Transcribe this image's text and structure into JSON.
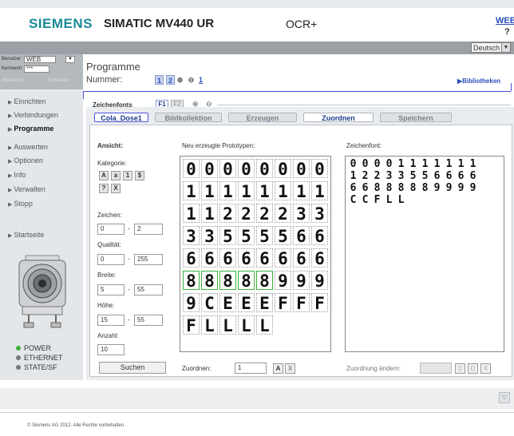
{
  "header": {
    "brand": "SIEMENS",
    "product": "SIMATIC MV440 UR",
    "mode": "OCR+",
    "web_link": "WEB",
    "help": "?",
    "language": "Deutsch"
  },
  "login": {
    "user_label": "Benutzer",
    "user_value": "WEB",
    "password_label": "Kennwort",
    "password_value": "***",
    "logout": "Abmelden",
    "login": "Anmelden"
  },
  "nav": {
    "items": [
      {
        "label": "Einrichten",
        "active": false
      },
      {
        "label": "Verbindungen",
        "active": false
      },
      {
        "label": "Programme",
        "active": true
      },
      {
        "label": "Auswerten",
        "active": false
      },
      {
        "label": "Optionen",
        "active": false
      },
      {
        "label": "Info",
        "active": false
      },
      {
        "label": "Verwalten",
        "active": false
      },
      {
        "label": "Stopp",
        "active": false
      }
    ],
    "home": "Startseite"
  },
  "status": {
    "power": "POWER",
    "ethernet": "ETHERNET",
    "state": "STATE/SF",
    "colors": {
      "power": "#3cb43c",
      "ethernet": "#777777",
      "state": "#777777"
    }
  },
  "programs": {
    "title": "Programme",
    "number_label": "Nummer:",
    "numbers": [
      "1",
      "2",
      "⊕",
      "⊖",
      "1"
    ],
    "library_link": "Bibliotheken"
  },
  "fonts": {
    "label": "Zeichenfonts",
    "f1": "F1",
    "f2": "F2",
    "add": "⊕",
    "remove": "⊖"
  },
  "tabs": [
    {
      "label": "Cola_Dose1",
      "selected": true
    },
    {
      "label": "Bildkollektion",
      "selected": false
    },
    {
      "label": "Erzeugen",
      "selected": false
    },
    {
      "label": "Zuordnen",
      "selected": true
    },
    {
      "label": "Speichern",
      "selected": false
    }
  ],
  "view": {
    "title": "Ansicht:",
    "category_label": "Kategorie:",
    "category_buttons": [
      "A",
      "a",
      "1",
      "$",
      "?",
      "X"
    ],
    "chars_label": "Zeichen:",
    "chars_from": "0",
    "chars_to": "2",
    "quality_label": "Qualität:",
    "quality_from": "0",
    "quality_to": "255",
    "width_label": "Breite:",
    "width_from": "5",
    "width_to": "55",
    "height_label": "Höhe:",
    "height_from": "15",
    "height_to": "55",
    "count_label": "Anzahl:",
    "count_value": "10",
    "dash": "-",
    "search_button": "Suchen"
  },
  "prototypes": {
    "label": "Neu erzeugte Prototypen:",
    "rows": [
      [
        "0",
        "0",
        "0",
        "0",
        "0",
        "0",
        "0",
        "0"
      ],
      [
        "1",
        "1",
        "1",
        "1",
        "1",
        "1",
        "1",
        "1"
      ],
      [
        "1",
        "1",
        "2",
        "2",
        "2",
        "2",
        "3",
        "3"
      ],
      [
        "3",
        "3",
        "5",
        "5",
        "5",
        "5",
        "6",
        "6"
      ],
      [
        "6",
        "6",
        "6",
        "6",
        "6",
        "6",
        "6",
        "6"
      ],
      [
        "8",
        "8",
        "8",
        "8",
        "8",
        "9",
        "9",
        "9"
      ],
      [
        "9",
        "C",
        "E",
        "E",
        "E",
        "F",
        "F",
        "F"
      ],
      [
        "F",
        "L",
        "L",
        "L",
        "L"
      ]
    ],
    "assign_label": "Zuordnen:",
    "assign_value": "1",
    "assign_a": "A",
    "assign_x": "X"
  },
  "charfont": {
    "label": "Zeichenfont:",
    "rows": [
      [
        "0",
        "0",
        "0",
        "0",
        "1",
        "1",
        "1",
        "1",
        "1",
        "1",
        "1"
      ],
      [
        "1",
        "2",
        "2",
        "3",
        "3",
        "5",
        "5",
        "6",
        "6",
        "6",
        "6"
      ],
      [
        "6",
        "6",
        "8",
        "8",
        "8",
        "8",
        "8",
        "9",
        "9",
        "9",
        "9"
      ],
      [
        "C",
        "C",
        "F",
        "L",
        "L"
      ]
    ],
    "change_label": "Zuordnung ändern:",
    "change_buttons": [
      "C",
      "D",
      "X"
    ]
  },
  "footer": {
    "copyright": "© Siemens AG 2012. Alle Rechte vorbehalten."
  }
}
